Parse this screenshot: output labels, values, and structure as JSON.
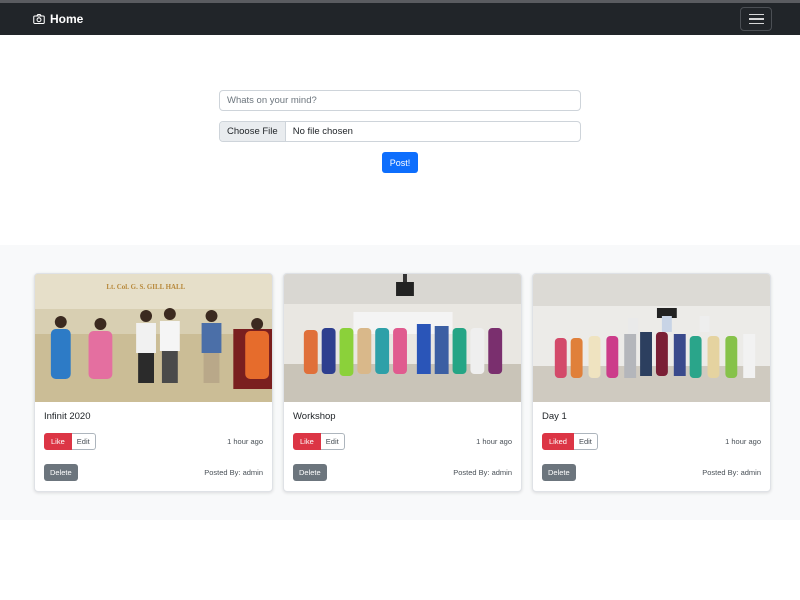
{
  "navbar": {
    "brand_label": "Home",
    "brand_icon": "camera-icon",
    "toggler_icon": "hamburger-icon"
  },
  "compose": {
    "placeholder": "Whats on your mind?",
    "file_button_label": "Choose File",
    "file_status": "No file chosen",
    "post_label": "Post!"
  },
  "posts": [
    {
      "title": "Infinit 2020",
      "like_label": "Like",
      "edit_label": "Edit",
      "time": "1 hour ago",
      "delete_label": "Delete",
      "posted_by": "Posted By: admin",
      "banner_text": "Lt. Col. G. S. GILL HALL"
    },
    {
      "title": "Workshop",
      "like_label": "Like",
      "edit_label": "Edit",
      "time": "1 hour ago",
      "delete_label": "Delete",
      "posted_by": "Posted By: admin"
    },
    {
      "title": "Day 1",
      "like_label": "Liked",
      "edit_label": "Edit",
      "time": "1 hour ago",
      "delete_label": "Delete",
      "posted_by": "Posted By: admin"
    }
  ],
  "colors": {
    "navbar": "#212529",
    "primary": "#0d6efd",
    "danger": "#dc3545",
    "secondary": "#6c757d",
    "feed_bg": "#f8f9fa"
  }
}
